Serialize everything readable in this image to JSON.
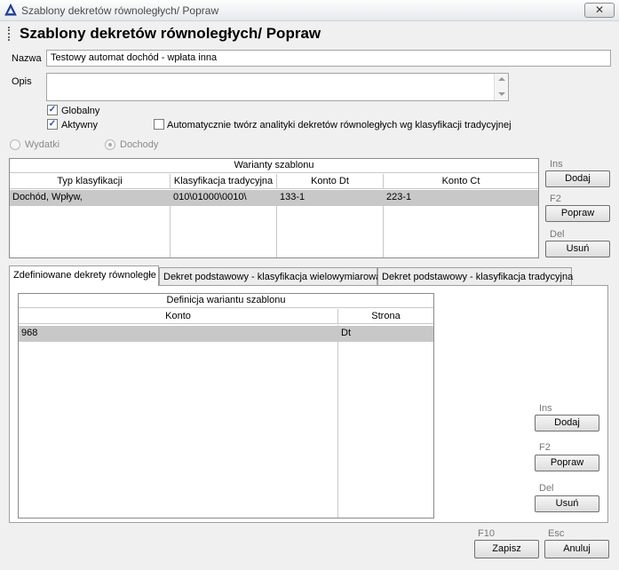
{
  "window": {
    "title": "Szablony dekretów równoległych/ Popraw",
    "close_label": "✕"
  },
  "header": {
    "title": "Szablony dekretów równoległych/ Popraw"
  },
  "form": {
    "nazwa_label": "Nazwa",
    "nazwa_value": "Testowy automat dochód - wpłata inna",
    "opis_label": "Opis",
    "opis_value": "",
    "globalny_label": "Globalny",
    "globalny_checked": "✓",
    "aktywny_label": "Aktywny",
    "aktywny_checked": "✓",
    "auto_label": "Automatycznie twórz analityki dekretów równoległych wg klasyfikacji tradycyjnej",
    "auto_checked": "",
    "radio_wydatki": "Wydatki",
    "radio_dochody": "Dochody"
  },
  "warianty": {
    "caption": "Warianty szablonu",
    "columns": [
      "Typ klasyfikacji",
      "Klasyfikacja tradycyjna",
      "Konto Dt",
      "Konto Ct"
    ],
    "rows": [
      [
        "Dochód, Wpływ,",
        "010\\01000\\0010\\",
        "133-1",
        "223-1"
      ]
    ],
    "buttons": [
      {
        "shortcut": "Ins",
        "label": "Dodaj"
      },
      {
        "shortcut": "F2",
        "label": "Popraw"
      },
      {
        "shortcut": "Del",
        "label": "Usuń"
      }
    ]
  },
  "tabs": [
    {
      "label": "Zdefiniowane dekrety równoległe"
    },
    {
      "label": "Dekret podstawowy - klasyfikacja wielowymiarowa"
    },
    {
      "label": "Dekret podstawowy - klasyfikacja tradycyjna"
    }
  ],
  "definicja": {
    "caption": "Definicja wariantu szablonu",
    "columns": [
      "Konto",
      "Strona"
    ],
    "rows": [
      [
        "968",
        "Dt"
      ]
    ],
    "buttons": [
      {
        "shortcut": "Ins",
        "label": "Dodaj"
      },
      {
        "shortcut": "F2",
        "label": "Popraw"
      },
      {
        "shortcut": "Del",
        "label": "Usuń"
      }
    ]
  },
  "footer": {
    "save_shortcut": "F10",
    "save_label": "Zapisz",
    "cancel_shortcut": "Esc",
    "cancel_label": "Anuluj"
  }
}
